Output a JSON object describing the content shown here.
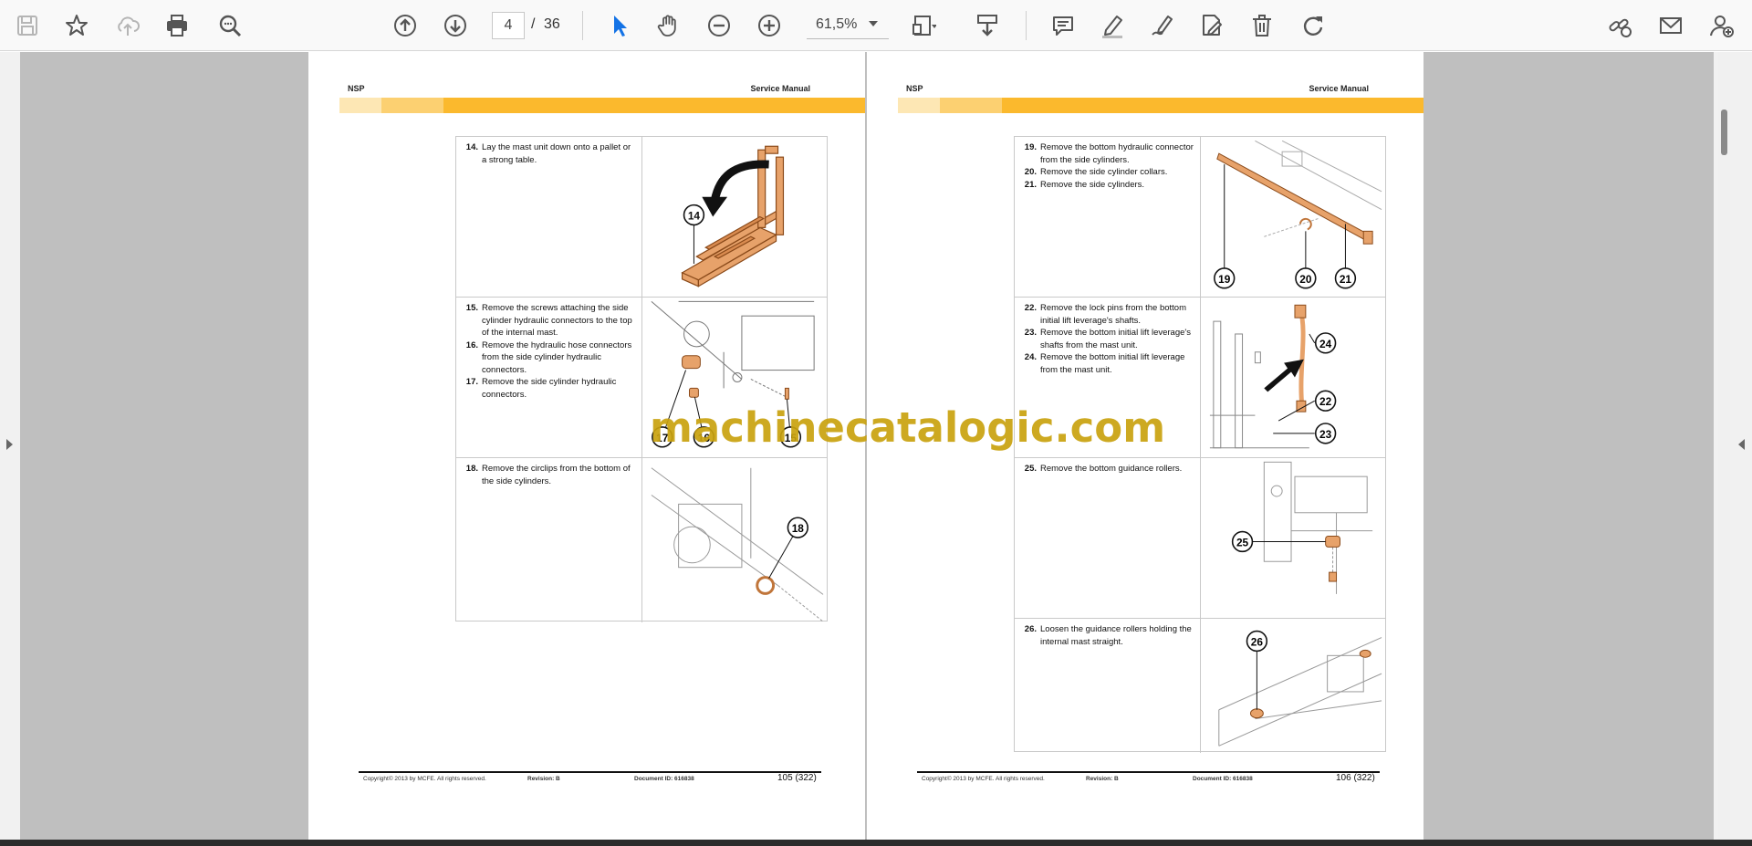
{
  "toolbar": {
    "page_current": "4",
    "page_separator": "/",
    "page_total": "36",
    "zoom": "61,5%",
    "left_icons": [
      "save-icon",
      "star-icon",
      "cloud-upload-icon",
      "print-icon",
      "zoom-search-icon"
    ],
    "nav_icons": [
      "page-up-icon",
      "page-down-icon"
    ],
    "zoom_icons": [
      "select-arrow-icon",
      "hand-icon",
      "zoom-out-icon",
      "zoom-in-icon"
    ],
    "tool_icons": [
      "fit-page-icon",
      "scroll-mode-icon",
      "comment-icon",
      "highlight-pen-icon",
      "draw-icon",
      "fill-sign-icon",
      "delete-icon",
      "rotate-icon"
    ],
    "right_icons": [
      "share-link-icon",
      "email-icon",
      "add-user-icon"
    ]
  },
  "pages": [
    {
      "header_left": "NSP",
      "header_right": "Service Manual",
      "rows": [
        {
          "steps": [
            {
              "num": "14.",
              "text": "Lay the mast unit down onto a pallet or a strong table."
            }
          ],
          "callouts": [
            "14"
          ]
        },
        {
          "steps": [
            {
              "num": "15.",
              "text": "Remove the screws attaching the side cylinder hydraulic connectors to the top of the internal mast."
            },
            {
              "num": "16.",
              "text": "Remove the hydraulic hose connectors from the side cylinder hydraulic connectors."
            },
            {
              "num": "17.",
              "text": "Remove the side cylinder hydraulic connectors."
            }
          ],
          "callouts": [
            "17",
            "16",
            "15"
          ]
        },
        {
          "steps": [
            {
              "num": "18.",
              "text": "Remove the circlips from the bottom of the side cylinders."
            }
          ],
          "callouts": [
            "18"
          ]
        }
      ],
      "footer": {
        "copyright": "Copyright© 2013 by MCFE. All rights reserved.",
        "revision": "Revision: B",
        "document": "Document ID: 616838",
        "page": "105 (322)"
      }
    },
    {
      "header_left": "NSP",
      "header_right": "Service Manual",
      "rows": [
        {
          "steps": [
            {
              "num": "19.",
              "text": "Remove the bottom hydraulic connector from the side cylinders."
            },
            {
              "num": "20.",
              "text": "Remove the side cylinder collars."
            },
            {
              "num": "21.",
              "text": "Remove the side cylinders."
            }
          ],
          "callouts": [
            "19",
            "20",
            "21"
          ]
        },
        {
          "steps": [
            {
              "num": "22.",
              "text": "Remove the lock pins from the bottom initial lift leverage's shafts."
            },
            {
              "num": "23.",
              "text": "Remove the bottom initial lift leverage's shafts from the mast unit."
            },
            {
              "num": "24.",
              "text": "Remove the bottom initial lift leverage from the mast unit."
            }
          ],
          "callouts": [
            "24",
            "22",
            "23"
          ]
        },
        {
          "steps": [
            {
              "num": "25.",
              "text": "Remove the bottom guidance rollers."
            }
          ],
          "callouts": [
            "25"
          ]
        },
        {
          "steps": [
            {
              "num": "26.",
              "text": "Loosen the guidance rollers holding the internal mast straight."
            }
          ],
          "callouts": [
            "26"
          ]
        }
      ],
      "footer": {
        "copyright": "Copyright© 2013 by MCFE. All rights reserved.",
        "revision": "Revision: B",
        "document": "Document ID: 616838",
        "page": "106 (322)"
      }
    }
  ],
  "watermark": "machinecatalogic.com",
  "colors": {
    "accent_band": "#fbb92d",
    "part_highlight": "#e08a4a",
    "selected_tool": "#1473e6",
    "watermark": "#c9a20f"
  }
}
